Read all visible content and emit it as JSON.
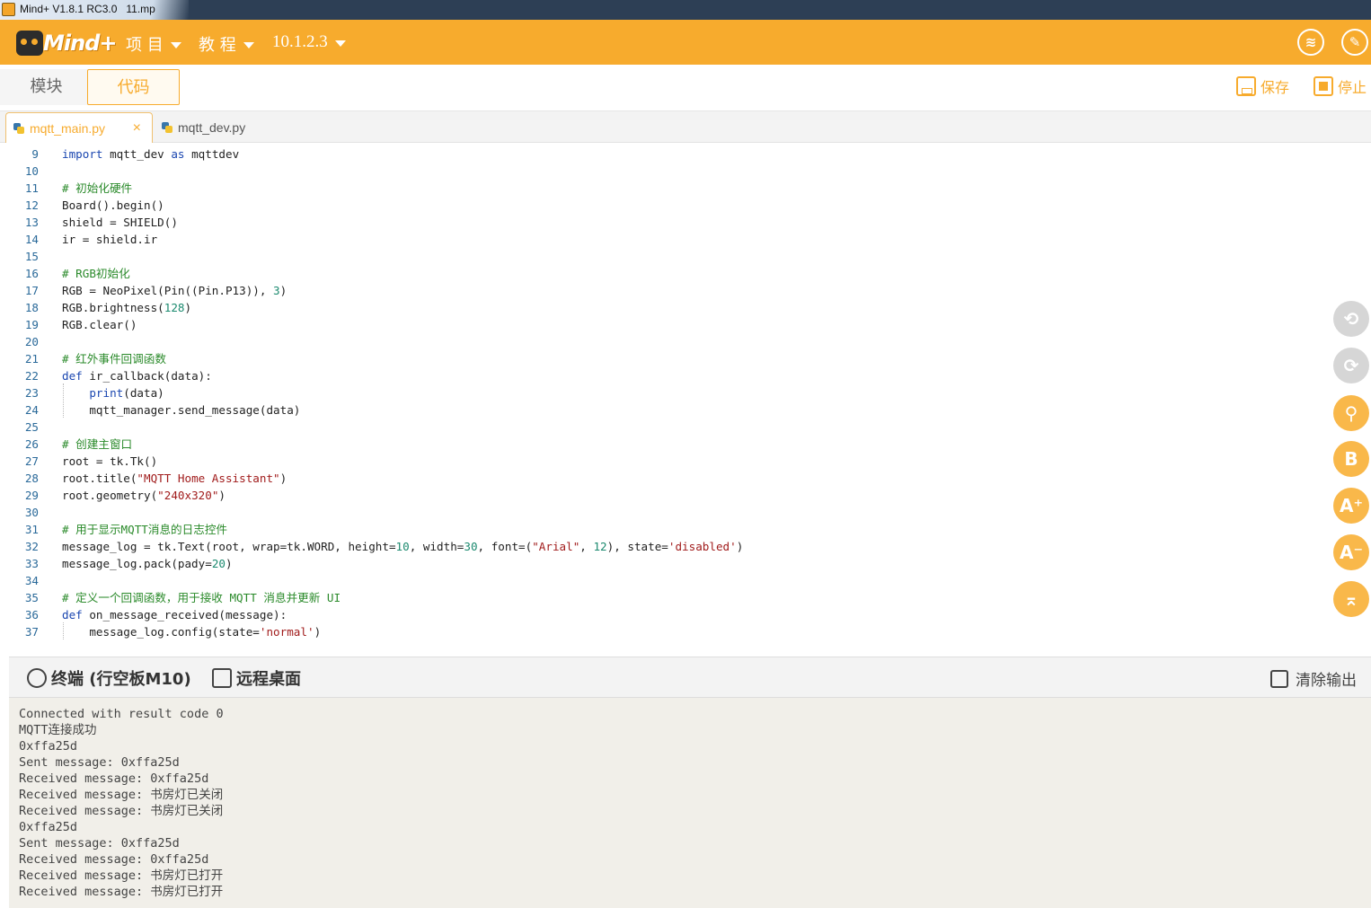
{
  "window": {
    "title": "Mind+ V1.8.1 RC3.0   11.mp"
  },
  "appbar": {
    "logo_text": "Mind+",
    "menus": [
      {
        "label": "项 目"
      },
      {
        "label": "教 程"
      },
      {
        "label": "10.1.2.3"
      }
    ],
    "right_icons": [
      "dashboard-icon",
      "edit-icon"
    ]
  },
  "modes": {
    "blocks": "模块",
    "code": "代码"
  },
  "actions": {
    "save": "保存",
    "stop": "停止"
  },
  "file_tabs": [
    {
      "name": "mqtt_main.py",
      "active": true,
      "close": "×"
    },
    {
      "name": "mqtt_dev.py",
      "active": false
    }
  ],
  "code": {
    "lines": [
      {
        "n": "9",
        "html": "<span class=\"kw\">import</span> mqtt_dev <span class=\"kw\">as</span> mqttdev"
      },
      {
        "n": "10",
        "html": ""
      },
      {
        "n": "11",
        "html": "<span class=\"cm\"># 初始化硬件</span>"
      },
      {
        "n": "12",
        "html": "Board().begin()"
      },
      {
        "n": "13",
        "html": "shield = SHIELD()"
      },
      {
        "n": "14",
        "html": "ir = shield.ir"
      },
      {
        "n": "15",
        "html": ""
      },
      {
        "n": "16",
        "html": "<span class=\"cm\"># RGB初始化</span>"
      },
      {
        "n": "17",
        "html": "RGB = NeoPixel(Pin((Pin.P13)), <span class=\"num\">3</span>)"
      },
      {
        "n": "18",
        "html": "RGB.brightness(<span class=\"num\">128</span>)"
      },
      {
        "n": "19",
        "html": "RGB.clear()"
      },
      {
        "n": "20",
        "html": ""
      },
      {
        "n": "21",
        "html": "<span class=\"cm\"># 红外事件回调函数</span>"
      },
      {
        "n": "22",
        "html": "<span class=\"kw\">def</span> ir_callback(data):"
      },
      {
        "n": "23",
        "html": "    <span class=\"fn\">print</span>(data)"
      },
      {
        "n": "24",
        "html": "    mqtt_manager.send_message(data)"
      },
      {
        "n": "25",
        "html": ""
      },
      {
        "n": "26",
        "html": "<span class=\"cm\"># 创建主窗口</span>"
      },
      {
        "n": "27",
        "html": "root = tk.Tk()"
      },
      {
        "n": "28",
        "html": "root.title(<span class=\"str\">\"MQTT Home Assistant\"</span>)"
      },
      {
        "n": "29",
        "html": "root.geometry(<span class=\"str\">\"240x320\"</span>)"
      },
      {
        "n": "30",
        "html": ""
      },
      {
        "n": "31",
        "html": "<span class=\"cm\"># 用于显示MQTT消息的日志控件</span>"
      },
      {
        "n": "32",
        "html": "message_log = tk.Text(root, wrap=tk.WORD, height=<span class=\"num\">10</span>, width=<span class=\"num\">30</span>, font=(<span class=\"str\">\"Arial\"</span>, <span class=\"num\">12</span>), state=<span class=\"str\">'disabled'</span>)"
      },
      {
        "n": "33",
        "html": "message_log.pack(pady=<span class=\"num\">20</span>)"
      },
      {
        "n": "34",
        "html": ""
      },
      {
        "n": "35",
        "html": "<span class=\"cm\"># 定义一个回调函数，用于接收 MQTT 消息并更新 UI</span>"
      },
      {
        "n": "36",
        "html": "<span class=\"kw\">def</span> on_message_received(message):"
      },
      {
        "n": "37",
        "html": "    message_log.config(state=<span class=\"str\">'normal'</span>)"
      }
    ]
  },
  "side_tools": [
    {
      "icon": "undo-icon",
      "glyph": "⟲",
      "enabled": false
    },
    {
      "icon": "redo-icon",
      "glyph": "⟳",
      "enabled": false
    },
    {
      "icon": "search-icon",
      "glyph": "⚲",
      "enabled": true
    },
    {
      "icon": "bold-icon",
      "glyph": "B",
      "enabled": true
    },
    {
      "icon": "font-increase-icon",
      "glyph": "A⁺",
      "enabled": true
    },
    {
      "icon": "font-decrease-icon",
      "glyph": "A⁻",
      "enabled": true
    },
    {
      "icon": "scroll-top-icon",
      "glyph": "⌅",
      "enabled": true
    }
  ],
  "terminal": {
    "tab_label": "终端 (行空板M10)",
    "remote_label": "远程桌面",
    "clear_label": "清除输出",
    "lines": [
      "Connected with result code 0",
      "MQTT连接成功",
      "0xffa25d",
      "Sent message: 0xffa25d",
      "Received message: 0xffa25d",
      "Received message: 书房灯已关闭",
      "Received message: 书房灯已关闭",
      "0xffa25d",
      "Sent message: 0xffa25d",
      "Received message: 0xffa25d",
      "Received message: 书房灯已打开",
      "Received message: 书房灯已打开"
    ]
  }
}
